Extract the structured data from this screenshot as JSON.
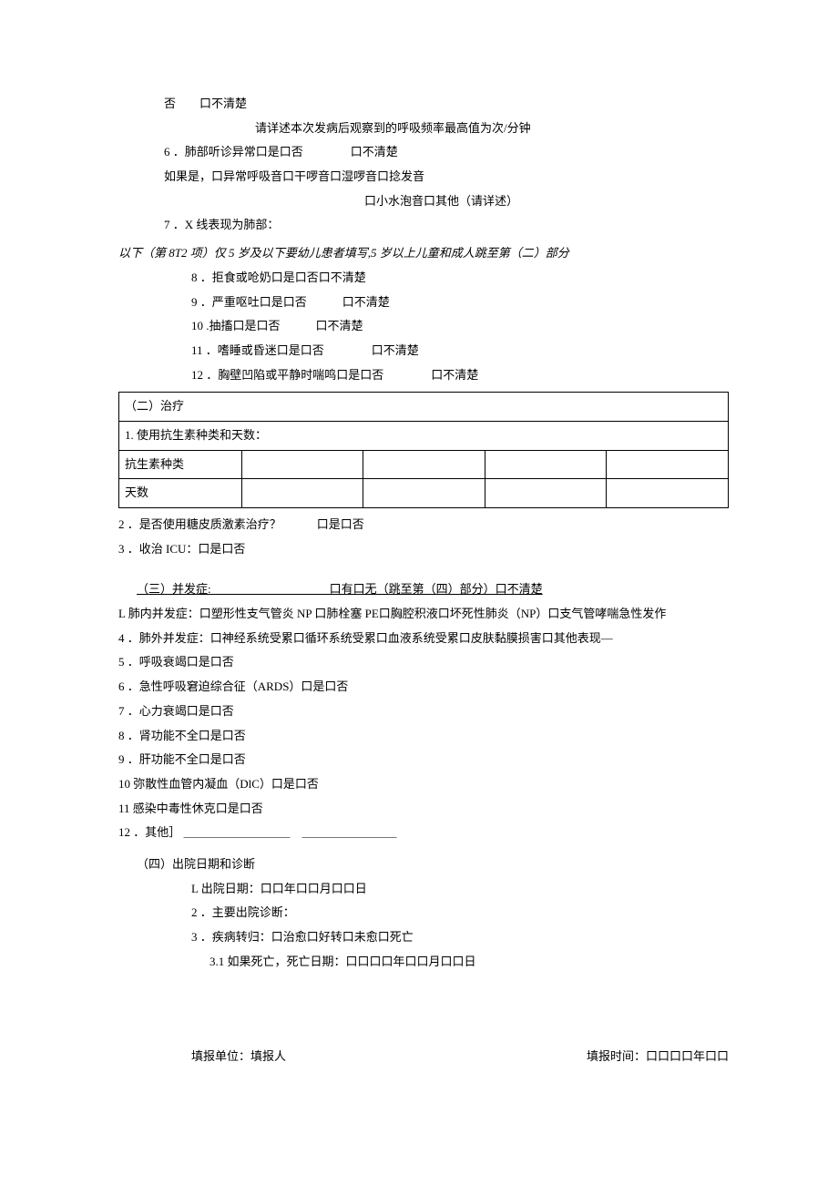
{
  "top": {
    "l1": "否　　口不清楚",
    "l2": "请详述本次发病后观察到的呼吸频率最高值为次/分钟",
    "l3": "6  ．肺部听诊异常口是口否　　　　口不清楚",
    "l4": "如果是，口异常呼吸音口干啰音口湿啰音口捻发音",
    "l5": "口小水泡音口其他（请详述）",
    "l6": "7  ．X 线表现为肺部："
  },
  "divider": "以下（第 8T2 项）仅 5 岁及以下要幼儿患者填写,5 岁以上儿童和成人跳至第（二）部分",
  "child": {
    "c8": "8  ．拒食或呛奶口是口否口不清楚",
    "c9": "9  ．严重呕吐口是口否　　　口不清楚",
    "c10": "10  .抽搐口是口否　　　口不清楚",
    "c11": "11  ．嗜睡或昏迷口是口否　　　　口不清楚",
    "c12": "12  ．胸壁凹陷或平静时喘鸣口是口否　　　　口不清楚"
  },
  "section2": {
    "title": "（二）治疗",
    "item1": "1. 使用抗生素种类和天数：",
    "rowA": "抗生素种类",
    "rowB": "天数",
    "item2": "2  ．是否使用糖皮质激素治疗？　　　口是口否",
    "item3": "3  ．收治 ICU：口是口否"
  },
  "section3": {
    "header": "（三）并发症:　　　　　　　　　　口有口无（跳至第（四）部分）口不清楚",
    "c1": "L 肺内并发症：口塑形性支气管炎 NP 口肺栓塞 PE口胸腔积液口坏死性肺炎（NP）口支气管哮喘急性发作",
    "c4": "4  ．肺外并发症：口神经系统受累口循环系统受累口血液系统受累口皮肤黏膜损害口其他表现—",
    "c5": "5  ．呼吸衰竭口是口否",
    "c6": "6  ．急性呼吸窘迫综合征（ARDS）口是口否",
    "c7": "7  ．心力衰竭口是口否",
    "c8": "8  ．肾功能不全口是口否",
    "c9": "9  ．肝功能不全口是口否",
    "c10": "10  弥散性血管内凝血（DlC）口是口否",
    "c11": "11  感染中毒性休克口是口否",
    "c12": "12  ．其他］ ＿＿＿＿＿＿＿＿＿　＿＿＿＿＿＿＿＿"
  },
  "section4": {
    "title": "（四）出院日期和诊断",
    "d1": "L 出院日期：口口年口口月口口日",
    "d2": "2  ．主要出院诊断：",
    "d3": "3  ．疾病转归：口治愈口好转口未愈口死亡",
    "d31": "3.1  如果死亡，死亡日期：口口口口年口口月口口日"
  },
  "footer": {
    "left": "填报单位：填报人",
    "right": "填报时间：口口口口年口口"
  }
}
